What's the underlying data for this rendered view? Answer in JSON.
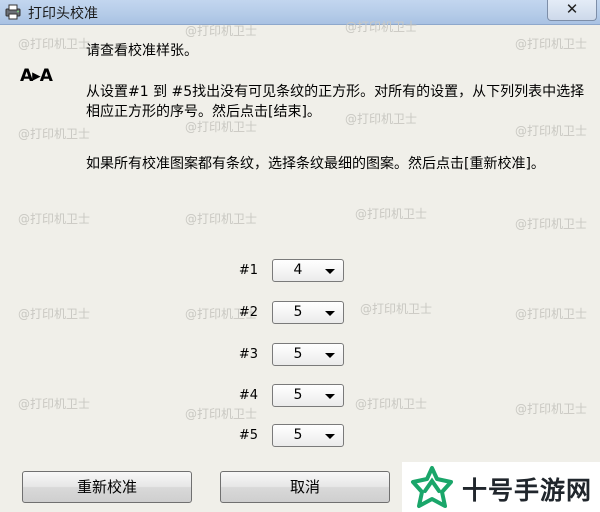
{
  "window": {
    "title": "打印头校准",
    "close_glyph": "✕"
  },
  "icons": {
    "app": "printer-icon",
    "alignment": "alignment-icon",
    "close": "close-icon",
    "dropdown": "chevron-down-icon"
  },
  "content": {
    "logo_glyph": "A▸A",
    "intro": "请查看校准样张。",
    "paragraph1": "从设置#1 到 #5找出没有可见条纹的正方形。对所有的设置，从下列列表中选择相应正方形的序号。然后点击[结束]。",
    "paragraph2": "如果所有校准图案都有条纹，选择条纹最细的图案。然后点击[重新校准]。"
  },
  "settings": [
    {
      "label": "#1",
      "value": "4"
    },
    {
      "label": "#2",
      "value": "5"
    },
    {
      "label": "#3",
      "value": "5"
    },
    {
      "label": "#4",
      "value": "5"
    },
    {
      "label": "#5",
      "value": "5"
    }
  ],
  "buttons": {
    "realign": "重新校准",
    "cancel": "取消"
  },
  "watermark": "@打印机卫士",
  "brand": {
    "name": "十号手游网",
    "accent": "#1aa66a",
    "text_color": "#20262c"
  }
}
